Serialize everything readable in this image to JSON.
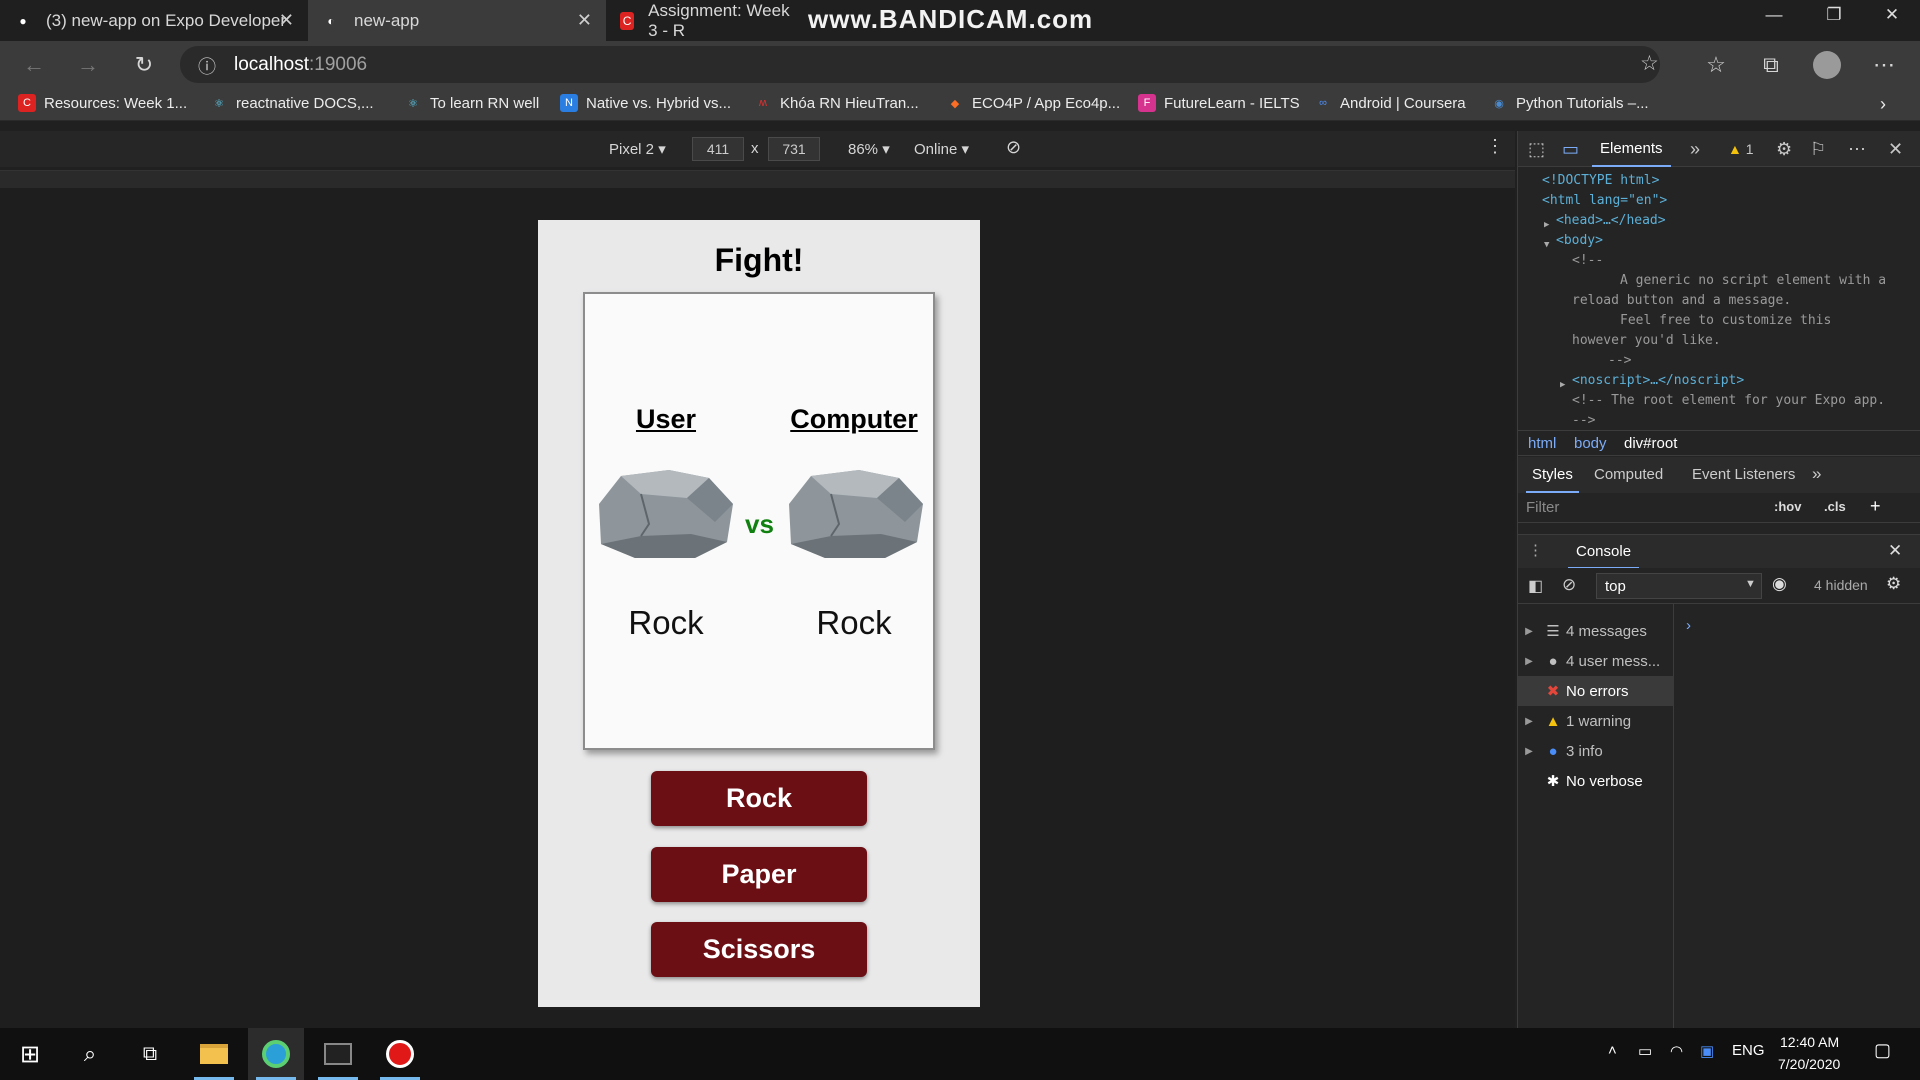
{
  "browser": {
    "tabs": [
      {
        "label": "(3) new-app on Expo Developer",
        "icon": "expo-icon"
      },
      {
        "label": "new-app",
        "icon": "expo-icon"
      },
      {
        "label": "Assignment: Week 3 - R",
        "icon": "coursera-icon"
      }
    ],
    "watermark": "www.BANDICAM.com",
    "url_host": "localhost",
    "url_port": ":19006",
    "bookmarks": [
      "Resources: Week 1...",
      "reactnative DOCS,...",
      "To learn RN well",
      "Native vs. Hybrid vs...",
      "Khóa RN HieuTran...",
      "ECO4P / App Eco4p...",
      "FutureLearn - IELTS",
      "Android | Coursera",
      "Python Tutorials –..."
    ]
  },
  "device_toolbar": {
    "device": "Pixel 2",
    "width": "411",
    "times": "x",
    "height": "731",
    "zoom": "86%",
    "network": "Online"
  },
  "app": {
    "title": "Fight!",
    "user_heading": "User",
    "computer_heading": "Computer",
    "vs": "vs",
    "user_choice": "Rock",
    "computer_choice": "Rock",
    "buttons": [
      "Rock",
      "Paper",
      "Scissors"
    ]
  },
  "devtools": {
    "elements_tab": "Elements",
    "warning_count": "1",
    "code_lines": [
      "<!DOCTYPE html>",
      "<html lang=\"en\">",
      "<head>…</head>",
      "<body>",
      "<!--",
      "A generic no script element with a",
      "reload button and a message.",
      "Feel free to customize this",
      "however you'd like.",
      "-->",
      "<noscript>…</noscript>",
      "<!-- The root element for your Expo app.",
      "-->"
    ],
    "breadcrumbs": [
      "html",
      "body",
      "div#root"
    ],
    "style_tabs": [
      "Styles",
      "Computed",
      "Event Listeners"
    ],
    "filter_placeholder": "Filter",
    "hov": ":hov",
    "cls": ".cls",
    "console_tab": "Console",
    "context": "top",
    "hidden_count": "4 hidden",
    "messages": [
      {
        "label": "4 messages",
        "icon": "list-icon"
      },
      {
        "label": "4 user mess...",
        "icon": "user-icon"
      },
      {
        "label": "No errors",
        "icon": "error-icon"
      },
      {
        "label": "1 warning",
        "icon": "warning-icon"
      },
      {
        "label": "3 info",
        "icon": "info-icon"
      },
      {
        "label": "No verbose",
        "icon": "bug-icon"
      }
    ]
  },
  "taskbar": {
    "lang": "ENG",
    "time": "12:40 AM",
    "date": "7/20/2020"
  },
  "colors": {
    "button_bg": "#6b0f15",
    "vs_color": "#108010",
    "accent": "#7cacf8"
  }
}
